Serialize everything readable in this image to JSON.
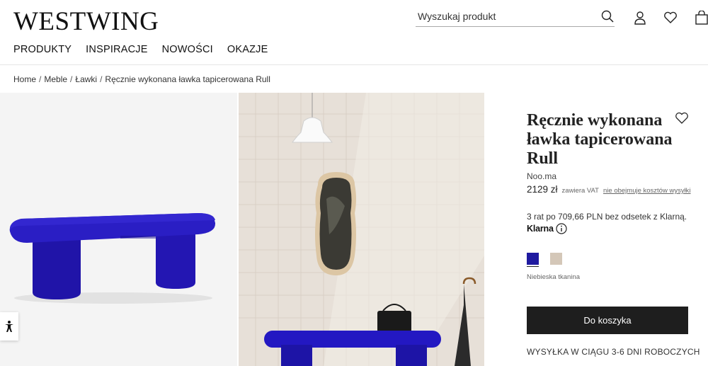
{
  "header": {
    "logo": "WESTWING",
    "search_placeholder": "Wyszukaj produkt",
    "nav": [
      "PRODUKTY",
      "INSPIRACJE",
      "NOWOŚCI",
      "OKAZJE"
    ]
  },
  "breadcrumb": [
    "Home",
    "Meble",
    "Ławki",
    "Ręcznie wykonana ławka tapicerowana Rull"
  ],
  "product": {
    "title": "Ręcznie wykonana ławka tapicerowana Rull",
    "brand": "Noo.ma",
    "price": "2129 zł",
    "vat_note": "zawiera VAT",
    "shipping_link": "nie obejmuje kosztów wysyłki",
    "installments": "3 rat po 709,66 PLN bez odsetek z Klarną.",
    "klarna": "Klarna",
    "swatches": [
      {
        "color": "#1f1aa0",
        "selected": true
      },
      {
        "color": "#d4c7b8",
        "selected": false
      }
    ],
    "color_name": "Niebieska tkanina",
    "add_to_cart": "Do koszyka",
    "delivery": "WYSYŁKA W CIĄGU 3-6 DNI ROBOCZYCH"
  },
  "icons": [
    "search-icon",
    "user-icon",
    "heart-icon",
    "bag-icon",
    "accessibility-icon",
    "info-icon"
  ],
  "colors": {
    "bench_blue": "#2316b8",
    "button_dark": "#1e1e1e"
  }
}
